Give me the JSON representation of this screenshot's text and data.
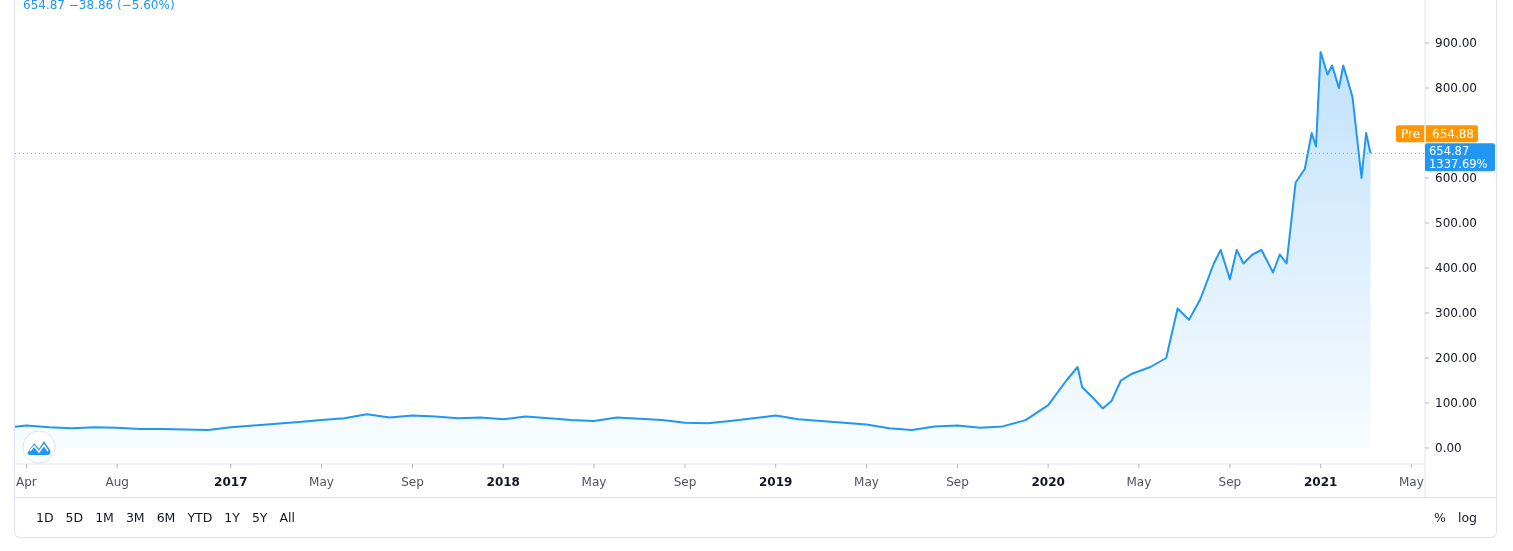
{
  "legend": {
    "text": "654.87 −38.86 (−5.60%)"
  },
  "chart": {
    "chart_data": {
      "type": "area",
      "x": [
        2016.208,
        2016.25,
        2016.333,
        2016.417,
        2016.5,
        2016.583,
        2016.667,
        2016.75,
        2016.833,
        2016.917,
        2017,
        2017.083,
        2017.167,
        2017.25,
        2017.333,
        2017.417,
        2017.5,
        2017.583,
        2017.667,
        2017.75,
        2017.833,
        2017.917,
        2018,
        2018.083,
        2018.167,
        2018.25,
        2018.333,
        2018.417,
        2018.5,
        2018.583,
        2018.667,
        2018.75,
        2018.833,
        2018.917,
        2019,
        2019.083,
        2019.167,
        2019.25,
        2019.333,
        2019.417,
        2019.5,
        2019.583,
        2019.667,
        2019.75,
        2019.833,
        2019.917,
        2020,
        2020.067,
        2020.108,
        2020.125,
        2020.167,
        2020.2,
        2020.233,
        2020.267,
        2020.308,
        2020.375,
        2020.433,
        2020.475,
        2020.517,
        2020.558,
        2020.608,
        2020.633,
        2020.667,
        2020.692,
        2020.717,
        2020.75,
        2020.783,
        2020.825,
        2020.85,
        2020.875,
        2020.908,
        2020.942,
        2020.967,
        2020.983,
        2021,
        2021.025,
        2021.042,
        2021.067,
        2021.083,
        2021.117,
        2021.15,
        2021.167,
        2021.183
      ],
      "series": [
        {
          "color": "#2196f3",
          "values": [
            47,
            50,
            46,
            44,
            46,
            45,
            42,
            42,
            41,
            40,
            46,
            50,
            54,
            58,
            62,
            66,
            75,
            68,
            72,
            70,
            66,
            68,
            64,
            70,
            66,
            62,
            60,
            68,
            65,
            62,
            56,
            55,
            60,
            66,
            72,
            64,
            60,
            56,
            52,
            44,
            40,
            48,
            50,
            45,
            48,
            62,
            95,
            150,
            180,
            135,
            110,
            88,
            105,
            150,
            165,
            180,
            200,
            310,
            285,
            330,
            410,
            440,
            375,
            440,
            410,
            430,
            440,
            390,
            430,
            410,
            590,
            620,
            700,
            670,
            880,
            830,
            850,
            800,
            850,
            780,
            600,
            700,
            655
          ]
        }
      ],
      "xlim": [
        2016.208,
        2021.383
      ],
      "ref_lines": [
        {
          "axis": "y",
          "value": 654.87
        }
      ],
      "ylim": [
        -35.6,
        995.6
      ],
      "xticks": [
        {
          "value": 2016.25,
          "label": "Apr"
        },
        {
          "value": 2016.583,
          "label": "Aug"
        },
        {
          "value": 2017,
          "label": "2017"
        },
        {
          "value": 2017.333,
          "label": "May"
        },
        {
          "value": 2017.667,
          "label": "Sep"
        },
        {
          "value": 2018,
          "label": "2018"
        },
        {
          "value": 2018.333,
          "label": "May"
        },
        {
          "value": 2018.667,
          "label": "Sep"
        },
        {
          "value": 2019,
          "label": "2019"
        },
        {
          "value": 2019.333,
          "label": "May"
        },
        {
          "value": 2019.667,
          "label": "Sep"
        },
        {
          "value": 2020,
          "label": "2020"
        },
        {
          "value": 2020.333,
          "label": "May"
        },
        {
          "value": 2020.667,
          "label": "Sep"
        },
        {
          "value": 2021,
          "label": "2021"
        },
        {
          "value": 2021.333,
          "label": "May"
        }
      ],
      "yticks": [
        {
          "value": 0,
          "label": "0.00"
        },
        {
          "value": 100,
          "label": "100.00"
        },
        {
          "value": 200,
          "label": "200.00"
        },
        {
          "value": 300,
          "label": "300.00"
        },
        {
          "value": 400,
          "label": "400.00"
        },
        {
          "value": 500,
          "label": "500.00"
        },
        {
          "value": 600,
          "label": "600.00"
        },
        {
          "value": 800,
          "label": "800.00"
        },
        {
          "value": 900,
          "label": "900.00"
        }
      ]
    },
    "price_labels": [
      {
        "kind": "pre",
        "tag": "Pre",
        "value": "654.88",
        "color": "#ff9800"
      },
      {
        "kind": "last",
        "value": "654.87",
        "percent": "1337.69%",
        "color": "#2196f3"
      }
    ]
  },
  "ranges": [
    "1D",
    "5D",
    "1M",
    "3M",
    "6M",
    "YTD",
    "1Y",
    "5Y",
    "All"
  ],
  "scale_buttons": [
    "%",
    "log"
  ]
}
